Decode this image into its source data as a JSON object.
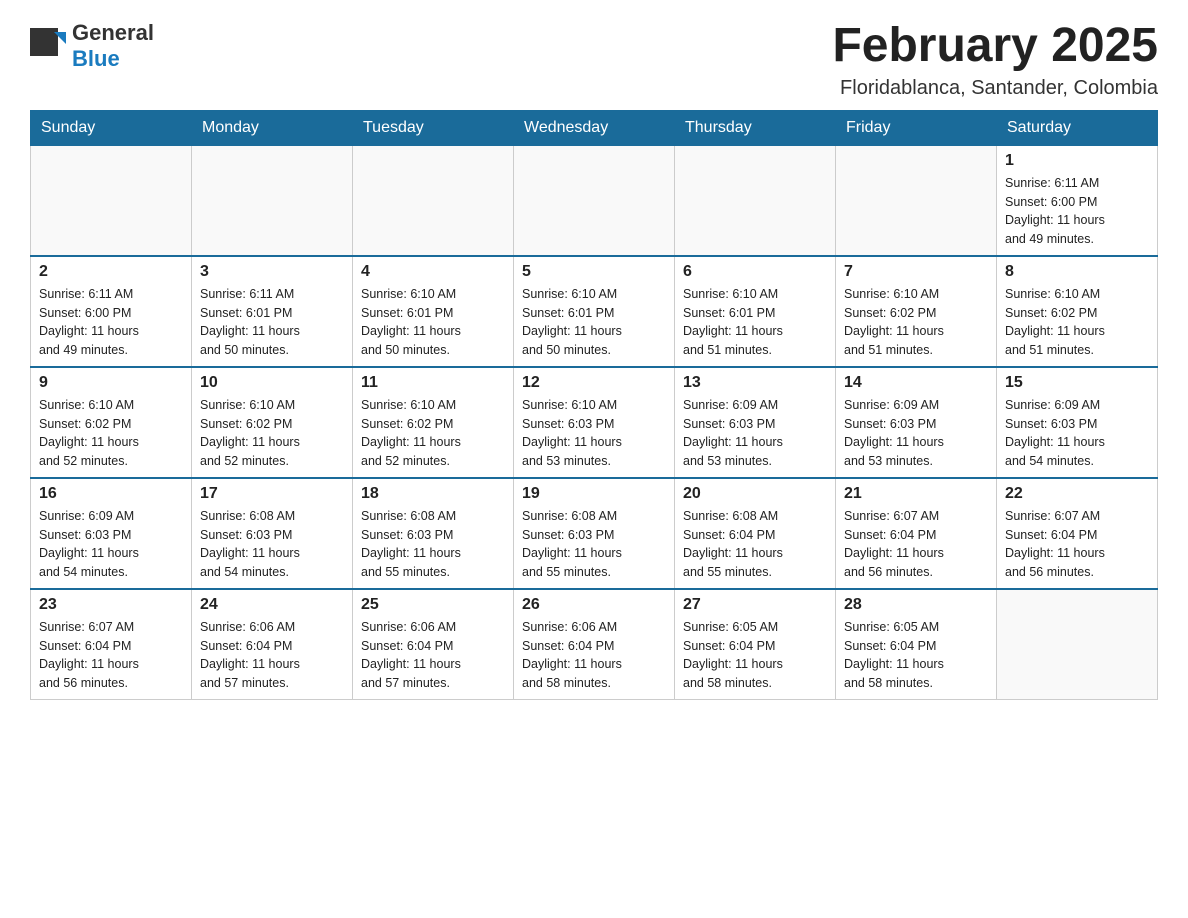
{
  "header": {
    "logo": {
      "general": "General",
      "blue": "Blue"
    },
    "title": "February 2025",
    "subtitle": "Floridablanca, Santander, Colombia"
  },
  "calendar": {
    "days_of_week": [
      "Sunday",
      "Monday",
      "Tuesday",
      "Wednesday",
      "Thursday",
      "Friday",
      "Saturday"
    ],
    "weeks": [
      [
        {
          "day": "",
          "info": ""
        },
        {
          "day": "",
          "info": ""
        },
        {
          "day": "",
          "info": ""
        },
        {
          "day": "",
          "info": ""
        },
        {
          "day": "",
          "info": ""
        },
        {
          "day": "",
          "info": ""
        },
        {
          "day": "1",
          "info": "Sunrise: 6:11 AM\nSunset: 6:00 PM\nDaylight: 11 hours\nand 49 minutes."
        }
      ],
      [
        {
          "day": "2",
          "info": "Sunrise: 6:11 AM\nSunset: 6:00 PM\nDaylight: 11 hours\nand 49 minutes."
        },
        {
          "day": "3",
          "info": "Sunrise: 6:11 AM\nSunset: 6:01 PM\nDaylight: 11 hours\nand 50 minutes."
        },
        {
          "day": "4",
          "info": "Sunrise: 6:10 AM\nSunset: 6:01 PM\nDaylight: 11 hours\nand 50 minutes."
        },
        {
          "day": "5",
          "info": "Sunrise: 6:10 AM\nSunset: 6:01 PM\nDaylight: 11 hours\nand 50 minutes."
        },
        {
          "day": "6",
          "info": "Sunrise: 6:10 AM\nSunset: 6:01 PM\nDaylight: 11 hours\nand 51 minutes."
        },
        {
          "day": "7",
          "info": "Sunrise: 6:10 AM\nSunset: 6:02 PM\nDaylight: 11 hours\nand 51 minutes."
        },
        {
          "day": "8",
          "info": "Sunrise: 6:10 AM\nSunset: 6:02 PM\nDaylight: 11 hours\nand 51 minutes."
        }
      ],
      [
        {
          "day": "9",
          "info": "Sunrise: 6:10 AM\nSunset: 6:02 PM\nDaylight: 11 hours\nand 52 minutes."
        },
        {
          "day": "10",
          "info": "Sunrise: 6:10 AM\nSunset: 6:02 PM\nDaylight: 11 hours\nand 52 minutes."
        },
        {
          "day": "11",
          "info": "Sunrise: 6:10 AM\nSunset: 6:02 PM\nDaylight: 11 hours\nand 52 minutes."
        },
        {
          "day": "12",
          "info": "Sunrise: 6:10 AM\nSunset: 6:03 PM\nDaylight: 11 hours\nand 53 minutes."
        },
        {
          "day": "13",
          "info": "Sunrise: 6:09 AM\nSunset: 6:03 PM\nDaylight: 11 hours\nand 53 minutes."
        },
        {
          "day": "14",
          "info": "Sunrise: 6:09 AM\nSunset: 6:03 PM\nDaylight: 11 hours\nand 53 minutes."
        },
        {
          "day": "15",
          "info": "Sunrise: 6:09 AM\nSunset: 6:03 PM\nDaylight: 11 hours\nand 54 minutes."
        }
      ],
      [
        {
          "day": "16",
          "info": "Sunrise: 6:09 AM\nSunset: 6:03 PM\nDaylight: 11 hours\nand 54 minutes."
        },
        {
          "day": "17",
          "info": "Sunrise: 6:08 AM\nSunset: 6:03 PM\nDaylight: 11 hours\nand 54 minutes."
        },
        {
          "day": "18",
          "info": "Sunrise: 6:08 AM\nSunset: 6:03 PM\nDaylight: 11 hours\nand 55 minutes."
        },
        {
          "day": "19",
          "info": "Sunrise: 6:08 AM\nSunset: 6:03 PM\nDaylight: 11 hours\nand 55 minutes."
        },
        {
          "day": "20",
          "info": "Sunrise: 6:08 AM\nSunset: 6:04 PM\nDaylight: 11 hours\nand 55 minutes."
        },
        {
          "day": "21",
          "info": "Sunrise: 6:07 AM\nSunset: 6:04 PM\nDaylight: 11 hours\nand 56 minutes."
        },
        {
          "day": "22",
          "info": "Sunrise: 6:07 AM\nSunset: 6:04 PM\nDaylight: 11 hours\nand 56 minutes."
        }
      ],
      [
        {
          "day": "23",
          "info": "Sunrise: 6:07 AM\nSunset: 6:04 PM\nDaylight: 11 hours\nand 56 minutes."
        },
        {
          "day": "24",
          "info": "Sunrise: 6:06 AM\nSunset: 6:04 PM\nDaylight: 11 hours\nand 57 minutes."
        },
        {
          "day": "25",
          "info": "Sunrise: 6:06 AM\nSunset: 6:04 PM\nDaylight: 11 hours\nand 57 minutes."
        },
        {
          "day": "26",
          "info": "Sunrise: 6:06 AM\nSunset: 6:04 PM\nDaylight: 11 hours\nand 58 minutes."
        },
        {
          "day": "27",
          "info": "Sunrise: 6:05 AM\nSunset: 6:04 PM\nDaylight: 11 hours\nand 58 minutes."
        },
        {
          "day": "28",
          "info": "Sunrise: 6:05 AM\nSunset: 6:04 PM\nDaylight: 11 hours\nand 58 minutes."
        },
        {
          "day": "",
          "info": ""
        }
      ]
    ]
  }
}
